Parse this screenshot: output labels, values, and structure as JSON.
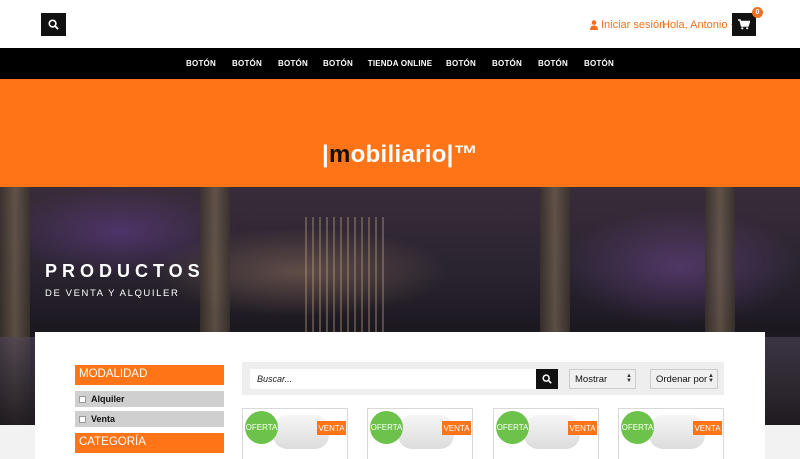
{
  "header": {
    "login_label": "Iniciar sesión",
    "greeting": "Hola, Antonio",
    "cart_count": "0"
  },
  "nav": {
    "items": [
      "BOTÓN",
      "BOTÓN",
      "BOTÓN",
      "BOTÓN",
      "TIENDA ONLINE",
      "BOTÓN",
      "BOTÓN",
      "BOTÓN",
      "BOTÓN"
    ]
  },
  "brand": {
    "logo_pre": "|",
    "logo_m": "m",
    "logo_rest": "obiliario|™"
  },
  "hero": {
    "title": "PRODUCTOS",
    "subtitle": "DE VENTA Y ALQUILER"
  },
  "sidebar": {
    "modalidad_label": "MODALIDAD",
    "options": [
      "Alquiler",
      "Venta"
    ],
    "categoria_label": "CATEGORÍA"
  },
  "toolbar": {
    "search_placeholder": "Buscar...",
    "show_select": "Mostrar",
    "sort_select": "Ordenar por"
  },
  "products": [
    {
      "badge": "OFERTA",
      "tag": "VENTA"
    },
    {
      "badge": "OFERTA",
      "tag": "VENTA"
    },
    {
      "badge": "OFERTA",
      "tag": "VENTA"
    },
    {
      "badge": "OFERTA",
      "tag": "VENTA"
    }
  ],
  "colors": {
    "accent": "#ff7417",
    "offer": "#6cc24a",
    "nav_bg": "#000000"
  },
  "icons": {
    "search": "search-icon",
    "user": "user-icon",
    "cart": "cart-icon"
  }
}
